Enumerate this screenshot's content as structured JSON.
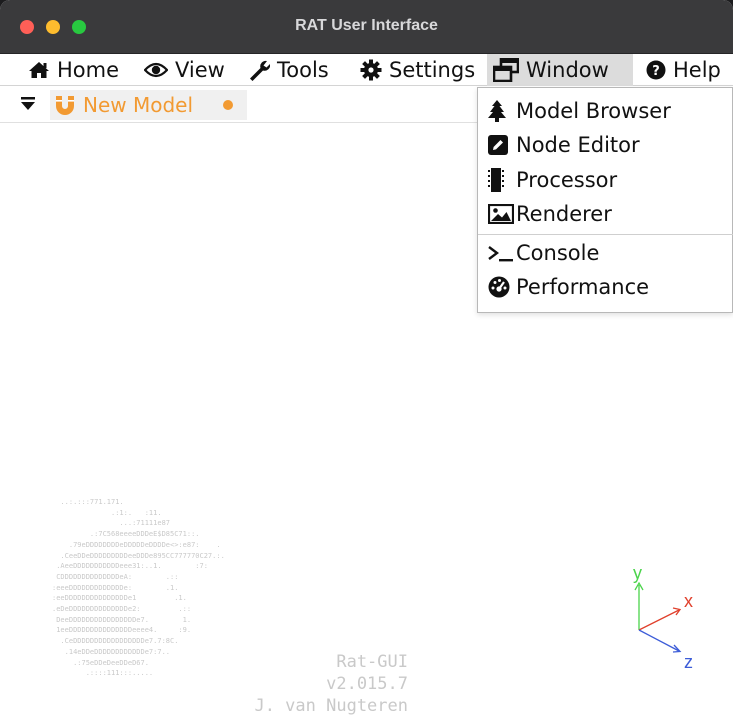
{
  "window": {
    "title": "RAT User Interface",
    "traffic_lights": [
      "close",
      "minimize",
      "maximize"
    ]
  },
  "menubar": {
    "items": [
      {
        "label": "Home",
        "icon": "home-icon"
      },
      {
        "label": "View",
        "icon": "eye-icon"
      },
      {
        "label": "Tools",
        "icon": "wrench-icon"
      },
      {
        "label": "Settings",
        "icon": "gear-icon"
      },
      {
        "label": "Window",
        "icon": "window-restore-icon",
        "active": true
      },
      {
        "label": "Help",
        "icon": "question-circle-icon"
      }
    ]
  },
  "tab": {
    "label": "New Model",
    "modified_indicator": "●",
    "color": "#f29a32"
  },
  "window_menu": {
    "items": [
      {
        "label": "Model Browser",
        "icon": "tree-icon"
      },
      {
        "label": "Node Editor",
        "icon": "pencil-square-icon"
      },
      {
        "label": "Processor",
        "icon": "chip-icon"
      },
      {
        "label": "Renderer",
        "icon": "image-icon"
      },
      {
        "label": "Console",
        "icon": "terminal-icon"
      },
      {
        "label": "Performance",
        "icon": "gauge-icon"
      }
    ]
  },
  "splash": {
    "ascii_art": "  ..:.:::771.171.\n              .:1:.   :11.\n                ...:71111e87\n         .:7C568eeeeDDDeE$D85C71::.\n    .79eDDDDDDDDeDDDDDeDDDDe<>:e87:    .\n  .CeeDDeDDDDDDDDDeeDDDe895CC777770C27.:.\n .AeeDDDDDDDDDDDeee31:..1.        :7:\n CDDDDDDDDDDDDDDeA:        .::\n:eeeDDDDDDDDDDDDDe:        .1.\n:eeDDDDDDDDDDDDDDDe1         .1.\n.eDeDDDDDDDDDDDDDDe2:         .::\n DeeDDDDDDDDDDDDDDDDe7.        1.\n 1eeDDDDDDDDDDDDDDDeeee4.     :9.\n  .CeDDDDDDDDDDDDDDDDDe7.7:8C.\n   .14eDDeDDDDDDDDDDDDe7:7..\n     .:75eDDeDeeDDeD67.\n        .::::111:::.....",
    "app_name": "Rat-GUI",
    "version": "v2.015.7",
    "author": "J. van Nugteren"
  },
  "axes": {
    "x_label": "x",
    "y_label": "y",
    "z_label": "z",
    "colors": {
      "x": "#e0402c",
      "y": "#4cd44c",
      "z": "#3c5cd8"
    }
  }
}
